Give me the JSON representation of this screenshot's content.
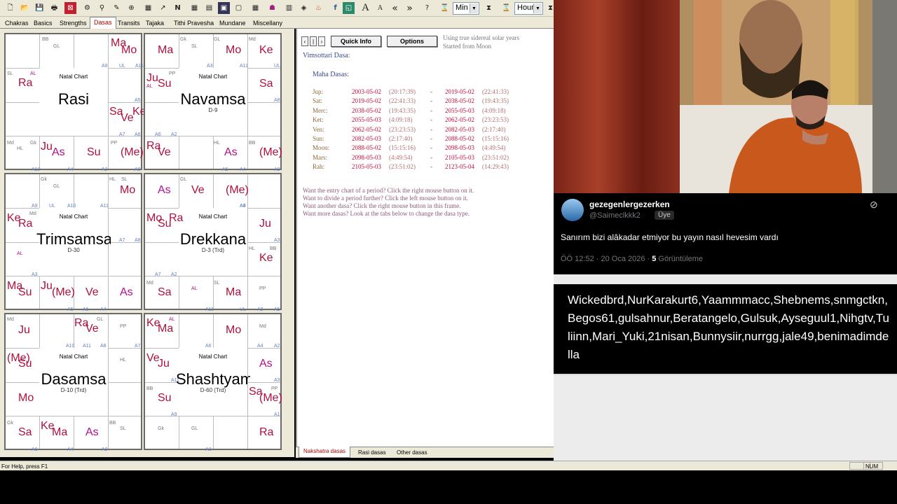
{
  "toolbar": {
    "dropdowns": [
      {
        "value": "Min"
      },
      {
        "value": "Hour"
      }
    ]
  },
  "tabs": [
    "Chakras",
    "Basics",
    "Strengths",
    "Dasas",
    "Transits",
    "Tajaka",
    "Tithi Pravesha",
    "Mundane",
    "Miscellany"
  ],
  "active_tab": "Dasas",
  "charts": [
    {
      "title": "Natal Chart",
      "name": "Rasi",
      "sub": "",
      "planets": [
        [
          "Ma",
          "c-red",
          150,
          5
        ],
        [
          "Mo",
          "c-red",
          165,
          15
        ],
        [
          "Ra",
          "c-red",
          18,
          62
        ],
        [
          "Sa",
          "c-red",
          148,
          103
        ],
        [
          "Ve",
          "c-red",
          164,
          112
        ],
        [
          "Ke",
          "c-red",
          181,
          103
        ],
        [
          "Ju",
          "c-red",
          50,
          153
        ],
        [
          "As",
          "c-mag",
          66,
          161
        ],
        [
          "Su",
          "c-red",
          116,
          161
        ],
        [
          "(Me)",
          "c-red",
          164,
          161
        ]
      ],
      "small": [
        [
          "BB",
          "c-grey",
          52,
          4
        ],
        [
          "GL",
          "c-grey",
          68,
          14
        ],
        [
          "A9",
          "c-blue",
          137,
          42
        ],
        [
          "UL",
          "c-blue",
          162,
          42
        ],
        [
          "A11",
          "c-blue",
          185,
          42
        ],
        [
          "SL",
          "c-grey",
          2,
          53
        ],
        [
          "AL",
          "c-mag",
          35,
          53
        ],
        [
          "A5",
          "c-blue",
          184,
          91
        ],
        [
          "A7",
          "c-blue",
          162,
          140
        ],
        [
          "A6",
          "c-blue",
          184,
          140
        ],
        [
          "Md",
          "c-grey",
          2,
          152
        ],
        [
          "HL",
          "c-grey",
          16,
          160
        ],
        [
          "Gk",
          "c-grey",
          35,
          152
        ],
        [
          "PP",
          "c-grey",
          150,
          152
        ],
        [
          "A10",
          "c-blue",
          37,
          190
        ],
        [
          "A4",
          "c-blue",
          88,
          190
        ],
        [
          "A2",
          "c-blue",
          137,
          190
        ],
        [
          "A8",
          "c-blue",
          184,
          190
        ]
      ]
    },
    {
      "title": "Natal Chart",
      "name": "Navamsa",
      "sub": "D-9",
      "planets": [
        [
          "Ma",
          "c-red",
          18,
          15
        ],
        [
          "Mo",
          "c-red",
          115,
          15
        ],
        [
          "Ke",
          "c-red",
          163,
          15
        ],
        [
          "Ju",
          "c-red",
          2,
          55
        ],
        [
          "Su",
          "c-red",
          18,
          63
        ],
        [
          "Sa",
          "c-red",
          163,
          63
        ],
        [
          "Ra",
          "c-red",
          2,
          152
        ],
        [
          "Ve",
          "c-red",
          18,
          161
        ],
        [
          "As",
          "c-mag",
          113,
          161
        ],
        [
          "(Me)",
          "c-red",
          163,
          161
        ]
      ],
      "small": [
        [
          "Gk",
          "c-grey",
          50,
          4
        ],
        [
          "SL",
          "c-grey",
          66,
          14
        ],
        [
          "GL",
          "c-grey",
          98,
          4
        ],
        [
          "Md",
          "c-grey",
          148,
          4
        ],
        [
          "A3",
          "c-blue",
          88,
          42
        ],
        [
          "A11",
          "c-blue",
          135,
          42
        ],
        [
          "UL",
          "c-blue",
          184,
          42
        ],
        [
          "PP",
          "c-grey",
          34,
          53
        ],
        [
          "AL",
          "c-mag",
          2,
          71
        ],
        [
          "A8",
          "c-blue",
          184,
          91
        ],
        [
          "A6",
          "c-blue",
          14,
          140
        ],
        [
          "A2",
          "c-blue",
          37,
          140
        ],
        [
          "HL",
          "c-grey",
          98,
          152
        ],
        [
          "BB",
          "c-grey",
          148,
          152
        ],
        [
          "A5",
          "c-blue",
          110,
          190
        ],
        [
          "A4",
          "c-blue",
          135,
          190
        ],
        [
          "A9",
          "c-blue",
          184,
          190
        ]
      ]
    },
    {
      "title": "Natal Chart",
      "name": "Trimsamsa",
      "sub": "D-30",
      "planets": [
        [
          "Mo",
          "c-red",
          163,
          15
        ],
        [
          "Ke",
          "c-red",
          2,
          55
        ],
        [
          "Ra",
          "c-red",
          18,
          63
        ],
        [
          "Ma",
          "c-red",
          2,
          152
        ],
        [
          "Su",
          "c-red",
          18,
          161
        ],
        [
          "Ju",
          "c-red",
          50,
          152
        ],
        [
          "(Me)",
          "c-red",
          66,
          161
        ],
        [
          "Ve",
          "c-red",
          114,
          161
        ],
        [
          "As",
          "c-mag",
          163,
          161
        ]
      ],
      "small": [
        [
          "Gk",
          "c-grey",
          50,
          4
        ],
        [
          "GL",
          "c-grey",
          68,
          14
        ],
        [
          "HL",
          "c-grey",
          148,
          4
        ],
        [
          "SL",
          "c-grey",
          165,
          4
        ],
        [
          "A9",
          "c-blue",
          37,
          42
        ],
        [
          "UL",
          "c-blue",
          62,
          42
        ],
        [
          "A10",
          "c-blue",
          88,
          42
        ],
        [
          "A11",
          "c-blue",
          135,
          42
        ],
        [
          "Md",
          "c-grey",
          34,
          53
        ],
        [
          "A7",
          "c-blue",
          162,
          91
        ],
        [
          "A8",
          "c-blue",
          184,
          91
        ],
        [
          "AL",
          "c-mag",
          16,
          110
        ],
        [
          "A3",
          "c-blue",
          37,
          140
        ],
        [
          "A5",
          "c-blue",
          88,
          190
        ],
        [
          "A6",
          "c-blue",
          110,
          190
        ],
        [
          "A4",
          "c-blue",
          135,
          190
        ]
      ]
    },
    {
      "title": "Natal Chart",
      "name": "Drekkana",
      "sub": "D-3 (Trd)",
      "planets": [
        [
          "As",
          "c-mag",
          18,
          15
        ],
        [
          "Ve",
          "c-red",
          66,
          15
        ],
        [
          "(Me)",
          "c-red",
          115,
          15
        ],
        [
          "Mo",
          "c-red",
          2,
          55
        ],
        [
          "Ra",
          "c-red",
          34,
          55
        ],
        [
          "Su",
          "c-red",
          18,
          63
        ],
        [
          "Ju",
          "c-red",
          163,
          63
        ],
        [
          "Ke",
          "c-red",
          163,
          112
        ],
        [
          "Sa",
          "c-red",
          18,
          161
        ],
        [
          "Ma",
          "c-red",
          115,
          161
        ]
      ],
      "small": [
        [
          "GL",
          "c-grey",
          50,
          4
        ],
        [
          "A4",
          "c-blue",
          135,
          42
        ],
        [
          "A6",
          "c-blue",
          135,
          42
        ],
        [
          "A3",
          "c-blue",
          184,
          91
        ],
        [
          "HL",
          "c-grey",
          148,
          103
        ],
        [
          "BB",
          "c-grey",
          178,
          103
        ],
        [
          "A7",
          "c-blue",
          14,
          140
        ],
        [
          "A2",
          "c-blue",
          37,
          140
        ],
        [
          "Md",
          "c-grey",
          2,
          152
        ],
        [
          "AL",
          "c-mag",
          66,
          160
        ],
        [
          "SL",
          "c-grey",
          98,
          152
        ],
        [
          "PP",
          "c-grey",
          163,
          160
        ],
        [
          "A11",
          "c-blue",
          86,
          190
        ],
        [
          "UL",
          "c-blue",
          135,
          190
        ],
        [
          "A9",
          "c-blue",
          160,
          190
        ],
        [
          "A5",
          "c-blue",
          184,
          190
        ]
      ]
    },
    {
      "title": "Natal Chart",
      "name": "Dasamsa",
      "sub": "D-10 (Trd)",
      "planets": [
        [
          "Ju",
          "c-red",
          18,
          15
        ],
        [
          "Ra",
          "c-red",
          98,
          5
        ],
        [
          "Ve",
          "c-red",
          114,
          13
        ],
        [
          "(Me)",
          "c-red",
          2,
          55
        ],
        [
          "Su",
          "c-red",
          18,
          63
        ],
        [
          "Mo",
          "c-red",
          18,
          112
        ],
        [
          "Sa",
          "c-red",
          18,
          161
        ],
        [
          "Ke",
          "c-red",
          50,
          152
        ],
        [
          "Ma",
          "c-red",
          66,
          161
        ],
        [
          "As",
          "c-mag",
          114,
          161
        ]
      ],
      "small": [
        [
          "Md",
          "c-grey",
          2,
          4
        ],
        [
          "GL",
          "c-grey",
          130,
          4
        ],
        [
          "PP",
          "c-grey",
          163,
          14
        ],
        [
          "A10",
          "c-blue",
          86,
          42
        ],
        [
          "A11",
          "c-blue",
          110,
          42
        ],
        [
          "A8",
          "c-blue",
          135,
          42
        ],
        [
          "A7",
          "c-blue",
          184,
          42
        ],
        [
          "HL",
          "c-grey",
          163,
          62
        ],
        [
          "Gk",
          "c-grey",
          2,
          152
        ],
        [
          "BB",
          "c-grey",
          148,
          152
        ],
        [
          "SL",
          "c-grey",
          163,
          160
        ],
        [
          "A6",
          "c-blue",
          37,
          190
        ],
        [
          "A4",
          "c-blue",
          88,
          190
        ],
        [
          "A9",
          "c-blue",
          137,
          190
        ]
      ]
    },
    {
      "title": "Natal Chart",
      "name": "Shashtyamsa",
      "sub": "D-60 (Trd)",
      "planets": [
        [
          "Ke",
          "c-red",
          2,
          5
        ],
        [
          "Ma",
          "c-red",
          18,
          13
        ],
        [
          "Mo",
          "c-red",
          115,
          15
        ],
        [
          "Ve",
          "c-red",
          2,
          55
        ],
        [
          "Ju",
          "c-red",
          18,
          63
        ],
        [
          "As",
          "c-mag",
          163,
          63
        ],
        [
          "Su",
          "c-red",
          18,
          112
        ],
        [
          "Sa",
          "c-red",
          148,
          103
        ],
        [
          "(Me)",
          "c-red",
          163,
          112
        ],
        [
          "Ra",
          "c-red",
          163,
          161
        ]
      ],
      "small": [
        [
          "AL",
          "c-mag",
          34,
          4
        ],
        [
          "Md",
          "c-grey",
          163,
          14
        ],
        [
          "A6",
          "c-blue",
          86,
          42
        ],
        [
          "A4",
          "c-blue",
          160,
          42
        ],
        [
          "A2",
          "c-blue",
          184,
          42
        ],
        [
          "A11",
          "c-blue",
          37,
          91
        ],
        [
          "A3",
          "c-blue",
          184,
          91
        ],
        [
          "BB",
          "c-grey",
          2,
          103
        ],
        [
          "PP",
          "c-grey",
          180,
          103
        ],
        [
          "A9",
          "c-blue",
          37,
          140
        ],
        [
          "A1",
          "c-blue",
          184,
          140
        ],
        [
          "Gk",
          "c-grey",
          18,
          160
        ],
        [
          "GL",
          "c-grey",
          66,
          160
        ],
        [
          "A8",
          "c-blue",
          86,
          190
        ]
      ]
    }
  ],
  "dasa": {
    "prev": "‹",
    "pause": "|",
    "next": "›",
    "quick_info": "Quick Info",
    "options": "Options",
    "note1": "Using true sidereal solar years",
    "note2": "Started from Moon",
    "system": "Vimsottari Dasa:",
    "heading": "Maha Dasas:",
    "rows": [
      {
        "planet": "Jup:",
        "start": "2003-05-02",
        "st": "(20:17:39)",
        "end": "2019-05-02",
        "et": "(22:41:33)"
      },
      {
        "planet": "Sat:",
        "start": "2019-05-02",
        "st": "(22:41:33)",
        "end": "2038-05-02",
        "et": "(19:43:35)"
      },
      {
        "planet": "Merc:",
        "start": "2038-05-02",
        "st": "(19:43:35)",
        "end": "2055-05-03",
        "et": "(4:09:18)"
      },
      {
        "planet": "Ket:",
        "start": "2055-05-03",
        "st": "(4:09:18)",
        "end": "2062-05-02",
        "et": "(23:23:53)"
      },
      {
        "planet": "Ven:",
        "start": "2062-05-02",
        "st": "(23:23:53)",
        "end": "2082-05-03",
        "et": "(2:17:40)"
      },
      {
        "planet": "Sun:",
        "start": "2082-05-03",
        "st": "(2:17:40)",
        "end": "2088-05-02",
        "et": "(15:15:16)"
      },
      {
        "planet": "Moon:",
        "start": "2088-05-02",
        "st": "(15:15:16)",
        "end": "2098-05-03",
        "et": "(4:49:54)"
      },
      {
        "planet": "Mars:",
        "start": "2098-05-03",
        "st": "(4:49:54)",
        "end": "2105-05-03",
        "et": "(23:51:02)"
      },
      {
        "planet": "Rah:",
        "start": "2105-05-03",
        "st": "(23:51:02)",
        "end": "2123-05-04",
        "et": "(14:29:43)"
      }
    ],
    "dash": "-",
    "help": [
      "Want the entry chart of a period? Click the right mouse button on it.",
      "Want to divide a period further? Click the left mouse button on it.",
      "Want another dasa? Click the right mouse button in this frame.",
      "Want more dasas? Look at the tabs below to change the dasa type."
    ]
  },
  "bottom_tabs": [
    "Nakshatra dasas",
    "Rasi dasas",
    "Other dasas"
  ],
  "active_bottom_tab": "Nakshatra dasas",
  "status": {
    "help": "For Help, press F1",
    "num": "NUM"
  },
  "tweet": {
    "name": "gezegenlergezerken",
    "handle": "@Saimeclkkk2",
    "badge": "Üye",
    "text": "Sanırım bizi alâkadar etmiyor bu yayın nasıl hevesim vardı",
    "time": "ÖÖ 12:52 · 20 Oca 2026 · ",
    "views_count": "5",
    "views_label": " Görüntüleme"
  },
  "names": "Wickedbrd,NurKarakurt6,Yaammmacc,Shebnems,snmgctkn,Begos61,gulsahnur,Beratangelo,Gulsuk,Ayseguul1,Nihgtv,Tuliinn,Mari_Yuki,21nisan,Bunnysiir,nurrgg,jale49,benimadimdella",
  "colors": {
    "planet": "#b0103c",
    "ascendant": "#b0108c",
    "arudha": "#6080c0",
    "dasa_date": "#c0103c",
    "dasa_time": "#b07070"
  }
}
